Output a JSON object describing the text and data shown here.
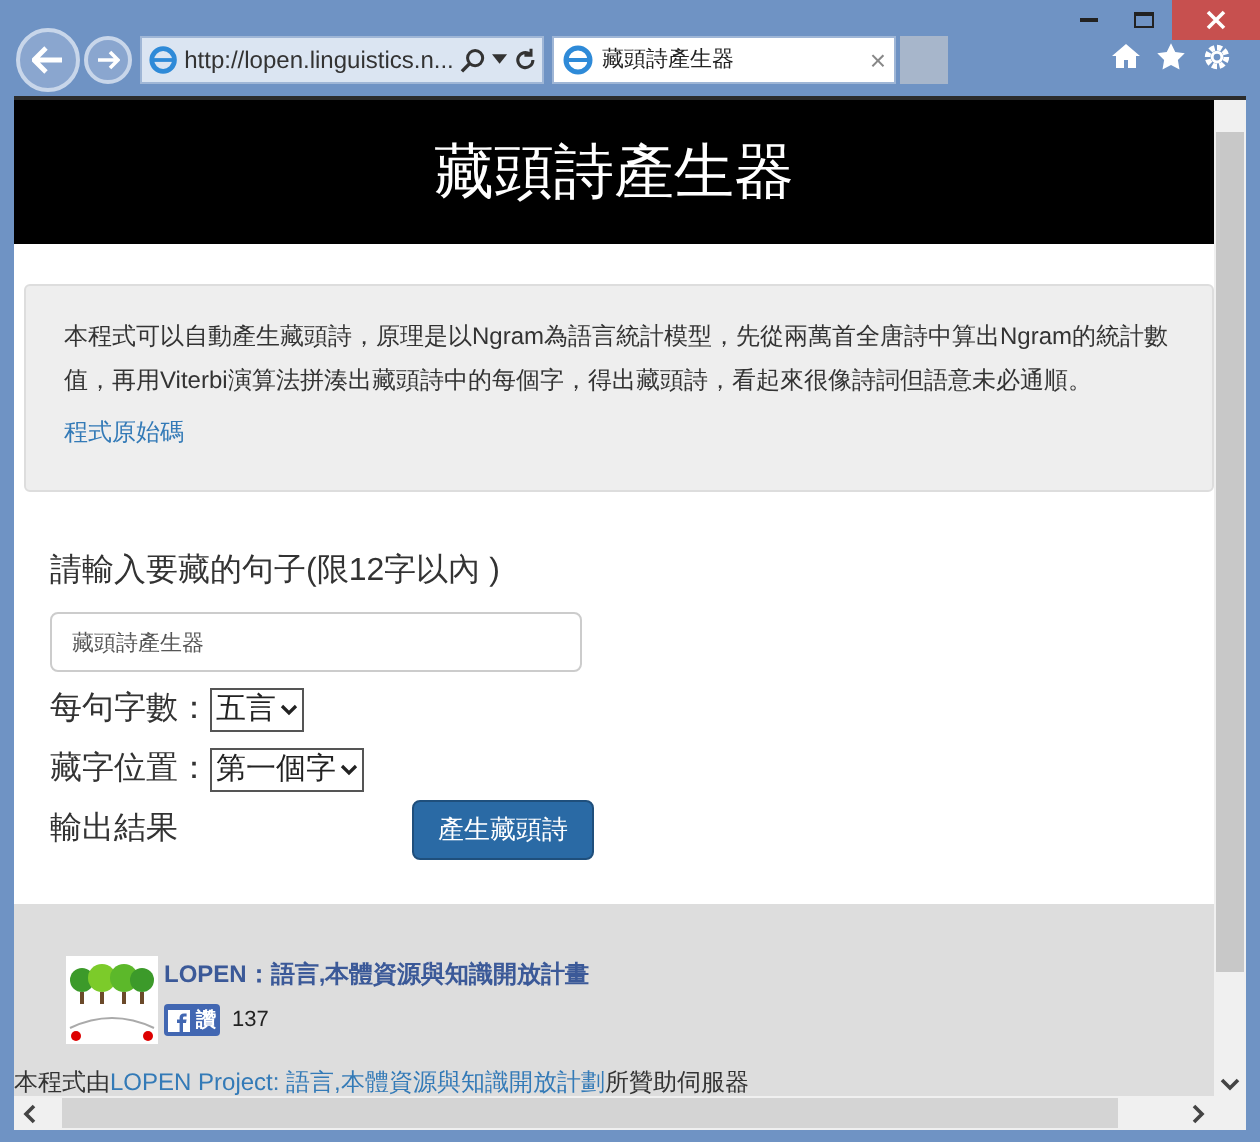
{
  "browser": {
    "address": "http://lopen.linguistics.n...",
    "tab": {
      "title": "藏頭詩產生器",
      "close": "×",
      "selected": true
    }
  },
  "header": {
    "title": "藏頭詩產生器"
  },
  "intro": {
    "text": "本程式可以自動產生藏頭詩，原理是以Ngram為語言統計模型，先從兩萬首全唐詩中算出Ngram的統計數值，再用Viterbi演算法拼湊出藏頭詩中的每個字，得出藏頭詩，看起來很像詩詞但語意未必通順。",
    "link": "程式原始碼"
  },
  "form": {
    "prompt": "請輸入要藏的句子(限12字以內 )",
    "input_value": "藏頭詩產生器",
    "selects": [
      {
        "label": "每句字數：",
        "value": "五言"
      },
      {
        "label": "藏字位置：",
        "value": "第一個字"
      }
    ],
    "output_label": "輸出結果",
    "button": "產生藏頭詩"
  },
  "footer": {
    "org": "LOPEN：語言,本體資源與知識開放計畫",
    "like": "讚",
    "count": "137",
    "sponsor_prefix": "本程式由",
    "sponsor_link": "LOPEN Project: 語言,本體資源與知識開放計劃",
    "sponsor_suffix": "所贊助伺服器"
  }
}
